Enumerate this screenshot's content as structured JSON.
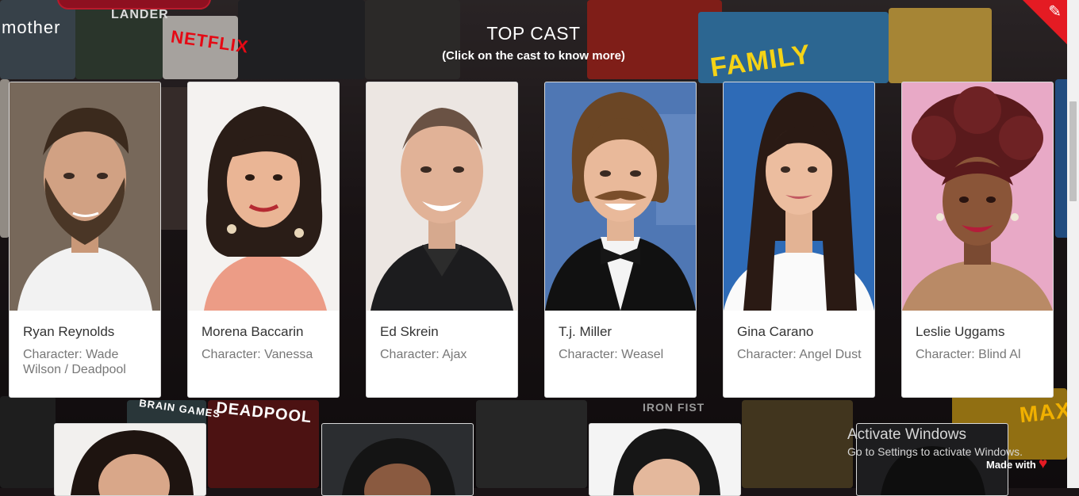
{
  "section": {
    "title": "TOP CAST",
    "subtitle": "(Click on the cast to know more)"
  },
  "cast": [
    {
      "name": "Ryan Reynolds",
      "character": "Character: Wade Wilson / Deadpool"
    },
    {
      "name": "Morena Baccarin",
      "character": "Character: Vanessa"
    },
    {
      "name": "Ed Skrein",
      "character": "Character: Ajax"
    },
    {
      "name": "T.j. Miller",
      "character": "Character: Weasel"
    },
    {
      "name": "Gina Carano",
      "character": "Character: Angel Dust"
    },
    {
      "name": "Leslie Uggams",
      "character": "Character: Blind Al"
    }
  ],
  "background": {
    "words": [
      "NETFLIX",
      "FAMILY",
      "BRAIN GAMES",
      "DEADPOOL",
      "MAX",
      "mother",
      "LANDER",
      "IRON FIST"
    ]
  },
  "watermark": {
    "line1": "Activate Windows",
    "line2": "Go to Settings to activate Windows."
  },
  "footer": {
    "made_with": "Made with",
    "heart_icon": "heart-icon"
  },
  "colors": {
    "accent": "#e41b23",
    "card_bg": "#ffffff",
    "name_text": "#333333",
    "role_text": "#777777"
  }
}
